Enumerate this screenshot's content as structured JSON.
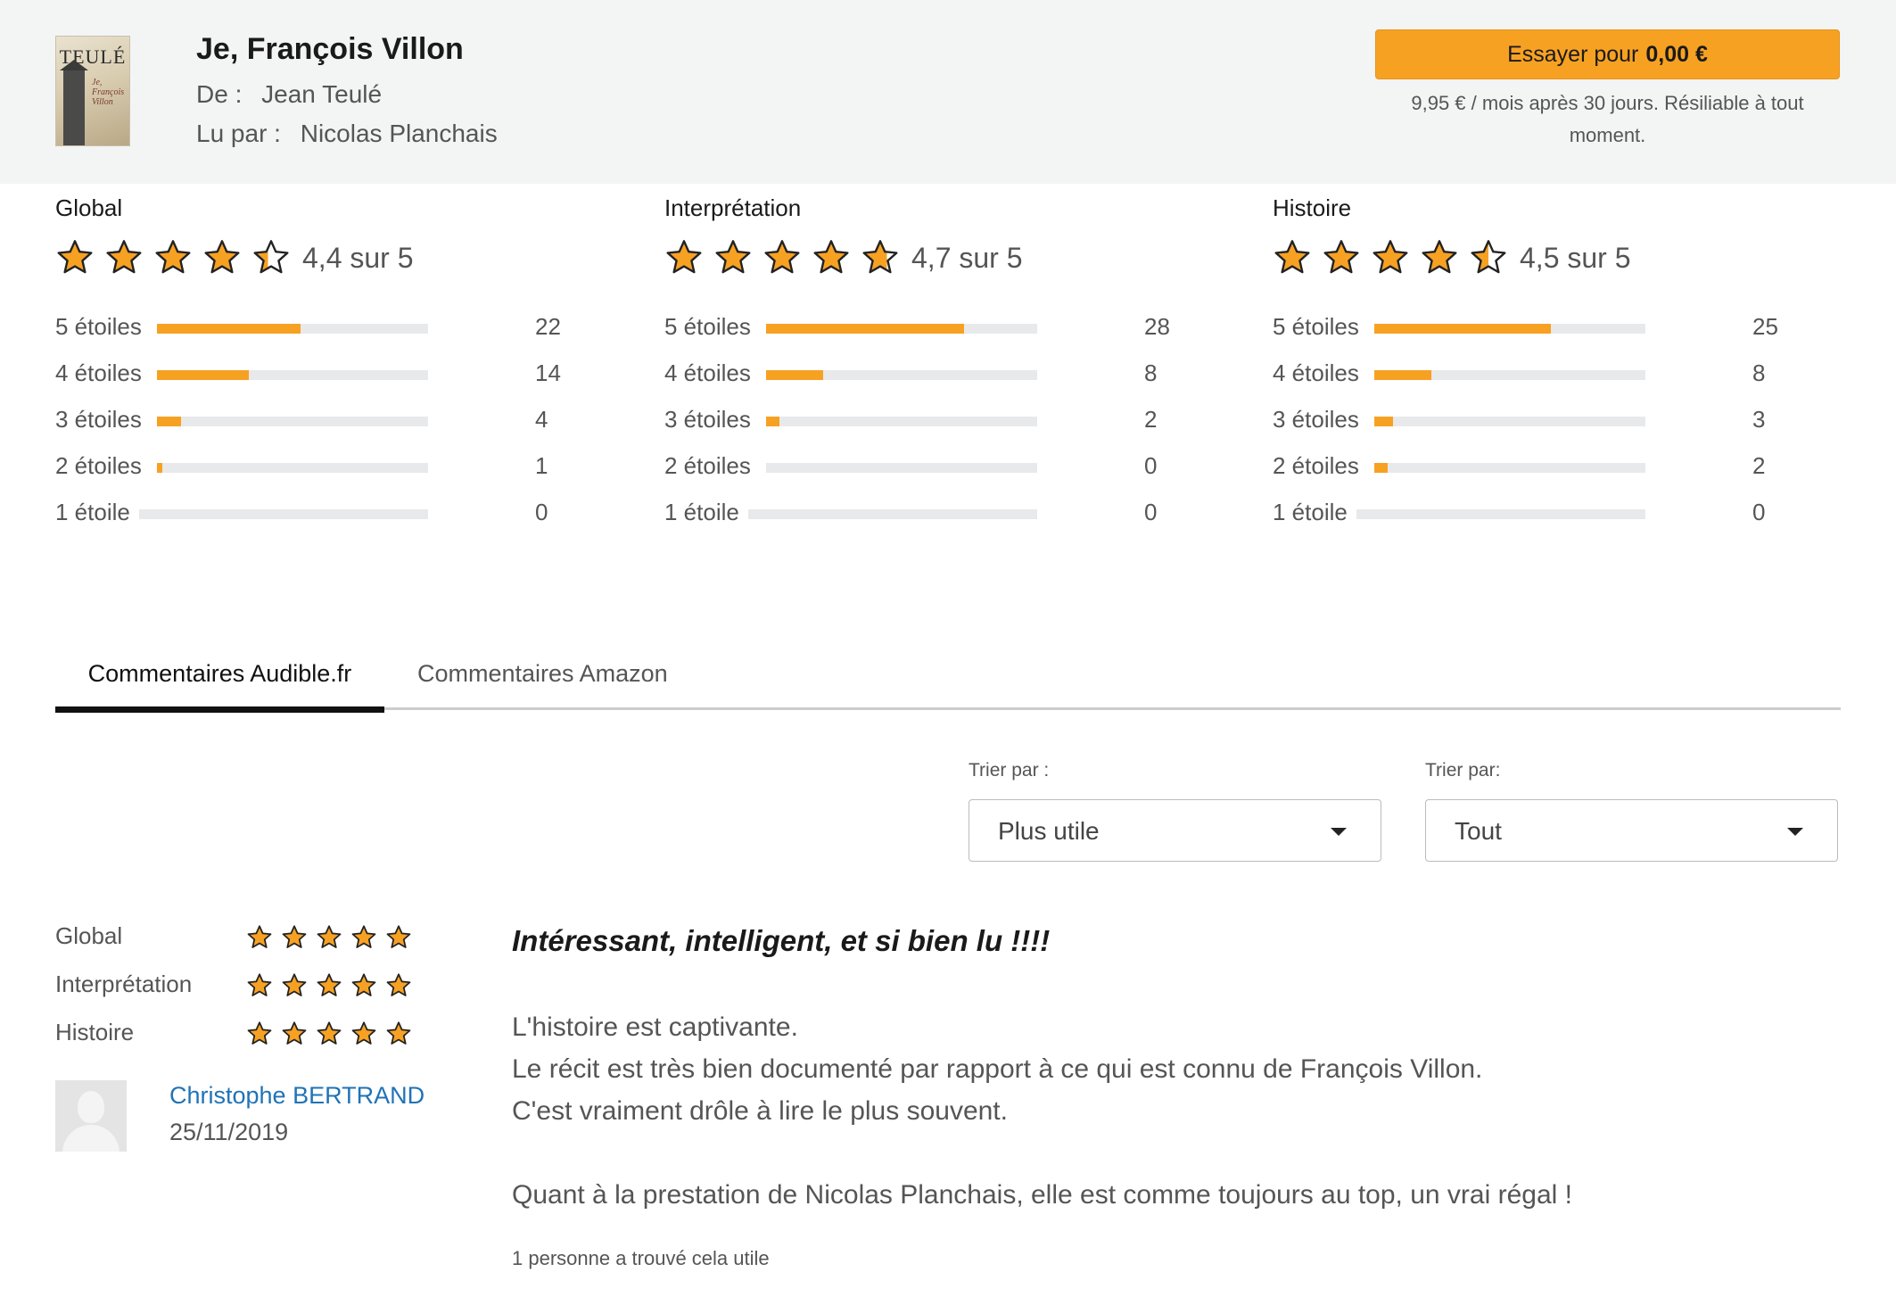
{
  "book": {
    "title": "Je, François Villon",
    "author_label": "De :",
    "author": "Jean Teulé",
    "narrator_label": "Lu par :",
    "narrator": "Nicolas Planchais",
    "cover": {
      "author_text": "TEULÉ",
      "title_text": "Je, François Villon"
    }
  },
  "cta": {
    "label": "Essayer pour",
    "price": "0,00 €",
    "note": "9,95 € / mois après 30 jours. Résiliable à tout moment."
  },
  "summaries": [
    {
      "title": "Global",
      "stars": 4.4,
      "score_text": "4,4 sur 5",
      "rows": [
        {
          "label": "5 étoiles",
          "count": "22",
          "fraction": 0.53
        },
        {
          "label": "4 étoiles",
          "count": "14",
          "fraction": 0.34
        },
        {
          "label": "3 étoiles",
          "count": "4",
          "fraction": 0.09
        },
        {
          "label": "2 étoiles",
          "count": "1",
          "fraction": 0.02
        },
        {
          "label": "1 étoile",
          "count": "0",
          "fraction": 0
        }
      ]
    },
    {
      "title": "Interprétation",
      "stars": 4.7,
      "score_text": "4,7 sur 5",
      "rows": [
        {
          "label": "5 étoiles",
          "count": "28",
          "fraction": 0.73
        },
        {
          "label": "4 étoiles",
          "count": "8",
          "fraction": 0.21
        },
        {
          "label": "3 étoiles",
          "count": "2",
          "fraction": 0.05
        },
        {
          "label": "2 étoiles",
          "count": "0",
          "fraction": 0
        },
        {
          "label": "1 étoile",
          "count": "0",
          "fraction": 0
        }
      ]
    },
    {
      "title": "Histoire",
      "stars": 4.5,
      "score_text": "4,5 sur 5",
      "rows": [
        {
          "label": "5 étoiles",
          "count": "25",
          "fraction": 0.65
        },
        {
          "label": "4 étoiles",
          "count": "8",
          "fraction": 0.21
        },
        {
          "label": "3 étoiles",
          "count": "3",
          "fraction": 0.07
        },
        {
          "label": "2 étoiles",
          "count": "2",
          "fraction": 0.05
        },
        {
          "label": "1 étoile",
          "count": "0",
          "fraction": 0
        }
      ]
    }
  ],
  "tabs": [
    {
      "label": "Commentaires Audible.fr",
      "active": true
    },
    {
      "label": "Commentaires Amazon",
      "active": false
    }
  ],
  "sort": [
    {
      "label": "Trier par :",
      "value": "Plus utile"
    },
    {
      "label": "Trier par:",
      "value": "Tout"
    }
  ],
  "review": {
    "ratings": [
      {
        "label": "Global",
        "stars": 5
      },
      {
        "label": "Interprétation",
        "stars": 5
      },
      {
        "label": "Histoire",
        "stars": 5
      }
    ],
    "reviewer": "Christophe BERTRAND",
    "date": "25/11/2019",
    "title": "Intéressant, intelligent, et si bien lu !!!!",
    "body": [
      "L'histoire est captivante.",
      "Le récit est très bien documenté par rapport à ce qui est connu de François Villon.",
      "C'est vraiment drôle à lire le plus souvent.",
      "",
      "Quant à la prestation de Nicolas Planchais, elle est comme toujours au top, un vrai régal !"
    ],
    "helpful": "1 personne a trouvé cela utile"
  },
  "colors": {
    "accent": "#f7a123",
    "track": "#e8e9ea",
    "link": "#1f73b7",
    "header_bg": "#f3f4f4"
  }
}
